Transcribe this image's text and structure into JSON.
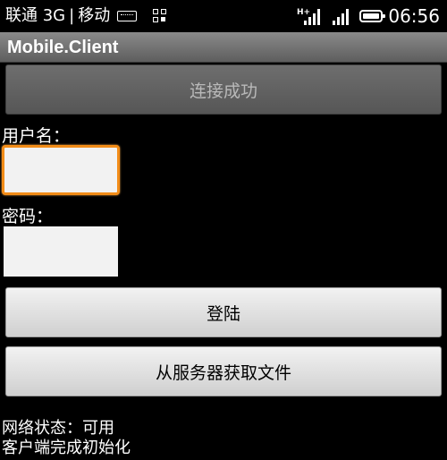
{
  "status_bar": {
    "carrier": "联通 3G",
    "separator": "|",
    "carrier2": "移动",
    "network_type": "H+",
    "time": "06:56",
    "icons": [
      "keyboard-icon",
      "grid-icon",
      "signal-icon",
      "signal-icon",
      "battery-icon"
    ]
  },
  "app": {
    "title": "Mobile.Client"
  },
  "form": {
    "connection_status": "连接成功",
    "username_label": "用户名：",
    "username_value": "",
    "password_label": "密码：",
    "password_value": "",
    "login_button": "登陆",
    "fetch_button": "从服务器获取文件"
  },
  "info": {
    "network_status": "网络状态：可用",
    "client_status": "客户端完成初始化"
  },
  "colors": {
    "focus_border": "#f28c18",
    "title_bar": "#6e6e6e",
    "background": "#000000"
  }
}
